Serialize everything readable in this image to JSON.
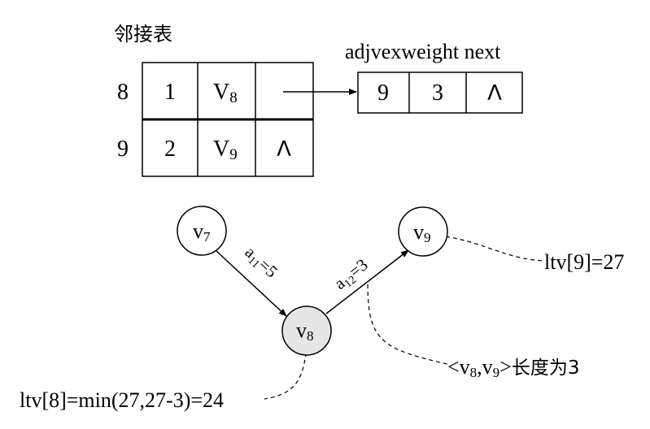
{
  "adjacency_title": "邻接表",
  "field_header": "adjvexweight next",
  "rows": [
    {
      "index": "8",
      "in": "1",
      "vname": "V",
      "vsub": "8",
      "last": ""
    },
    {
      "index": "9",
      "in": "2",
      "vname": "V",
      "vsub": "9",
      "last": "Λ"
    }
  ],
  "edge_node": {
    "adjvex": "9",
    "weight": "3",
    "next": "Λ"
  },
  "graph": {
    "nodes": [
      {
        "id": "v7",
        "name": "v",
        "sub": "7",
        "shaded": false
      },
      {
        "id": "v8",
        "name": "v",
        "sub": "8",
        "shaded": true
      },
      {
        "id": "v9",
        "name": "v",
        "sub": "9",
        "shaded": false
      }
    ],
    "edges": [
      {
        "name": "a",
        "sub": "11",
        "weight": "=5"
      },
      {
        "name": "a",
        "sub": "12",
        "weight": "=3"
      }
    ]
  },
  "annotations": {
    "ltv9": "ltv[9]=27",
    "ltv8": "ltv[8]=min(27,27-3)=24",
    "edge_length": {
      "open": "<",
      "v1": "v",
      "s1": "8",
      "sep": ",",
      "v2": "v",
      "s2": "9",
      "close": ">",
      "suffix": "长度为3"
    }
  },
  "colors": {
    "line": "#000000",
    "shaded_node": "#e6e6e6",
    "background": "#ffffff"
  }
}
